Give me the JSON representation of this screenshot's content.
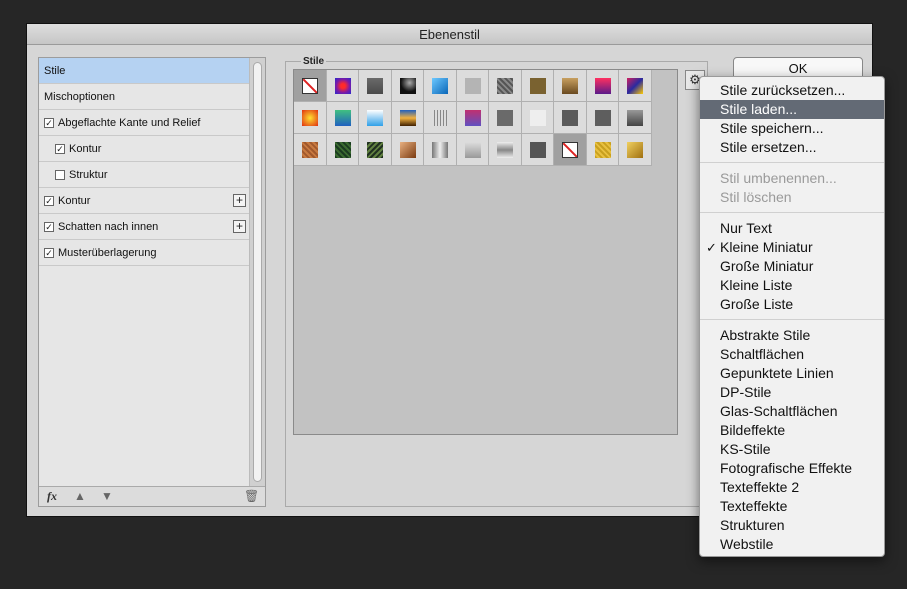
{
  "dialog": {
    "title": "Ebenenstil"
  },
  "effects": [
    {
      "label": "Stile",
      "checkbox": false,
      "selected": true,
      "indent": false,
      "plus": false
    },
    {
      "label": "Mischoptionen",
      "checkbox": false,
      "selected": false,
      "indent": false,
      "plus": false
    },
    {
      "label": "Abgeflachte Kante und Relief",
      "checkbox": true,
      "checked": true,
      "selected": false,
      "indent": false,
      "plus": false
    },
    {
      "label": "Kontur",
      "checkbox": true,
      "checked": true,
      "selected": false,
      "indent": true,
      "plus": false
    },
    {
      "label": "Struktur",
      "checkbox": true,
      "checked": false,
      "selected": false,
      "indent": true,
      "plus": false
    },
    {
      "label": "Kontur",
      "checkbox": true,
      "checked": true,
      "selected": false,
      "indent": false,
      "plus": true
    },
    {
      "label": "Schatten nach innen",
      "checkbox": true,
      "checked": true,
      "selected": false,
      "indent": false,
      "plus": true
    },
    {
      "label": "Musterüberlagerung",
      "checkbox": true,
      "checked": true,
      "selected": false,
      "indent": false,
      "plus": false
    }
  ],
  "footer": {
    "fx": "fx",
    "up_icon": "arrow-up-icon",
    "down_icon": "arrow-down-icon",
    "trash_icon": "trash-icon"
  },
  "stile_group": {
    "label": "Stile"
  },
  "ok_button": {
    "label": "OK"
  },
  "gear_icon": "gear-icon",
  "swatches": [
    "none",
    "radial-purple-red",
    "gray-square",
    "dark-glossy",
    "blue-glass",
    "light-gray",
    "textured-dark",
    "brown",
    "brown-gradient",
    "red-purple",
    "purple-mix",
    "yellow-red",
    "green-blue",
    "sky-blue",
    "sunset",
    "outline-gray",
    "blue-pink",
    "gray",
    "white-outline",
    "dark-gray",
    "dark-gray-2",
    "gradient-gray",
    "copper",
    "dark-green",
    "green-texture",
    "copper-bevel",
    "silver",
    "silver-light",
    "silver-gradient",
    "charcoal",
    "none",
    "gold",
    "gold-2"
  ],
  "selected_swatches": [
    0,
    30
  ],
  "menu": {
    "items": [
      {
        "label": "Stile zurücksetzen...",
        "state": "normal"
      },
      {
        "label": "Stile laden...",
        "state": "highlight"
      },
      {
        "label": "Stile speichern...",
        "state": "normal"
      },
      {
        "label": "Stile ersetzen...",
        "state": "normal"
      },
      {
        "label": "Stil umbenennen...",
        "state": "disabled"
      },
      {
        "label": "Stil löschen",
        "state": "disabled"
      },
      {
        "label": "Nur Text",
        "state": "normal"
      },
      {
        "label": "Kleine Miniatur",
        "state": "checked"
      },
      {
        "label": "Große Miniatur",
        "state": "normal"
      },
      {
        "label": "Kleine Liste",
        "state": "normal"
      },
      {
        "label": "Große Liste",
        "state": "normal"
      },
      {
        "label": "Abstrakte Stile",
        "state": "normal"
      },
      {
        "label": "Schaltflächen",
        "state": "normal"
      },
      {
        "label": "Gepunktete Linien",
        "state": "normal"
      },
      {
        "label": "DP-Stile",
        "state": "normal"
      },
      {
        "label": "Glas-Schaltflächen",
        "state": "normal"
      },
      {
        "label": "Bildeffekte",
        "state": "normal"
      },
      {
        "label": "KS-Stile",
        "state": "normal"
      },
      {
        "label": "Fotografische Effekte",
        "state": "normal"
      },
      {
        "label": "Texteffekte 2",
        "state": "normal"
      },
      {
        "label": "Texteffekte",
        "state": "normal"
      },
      {
        "label": "Strukturen",
        "state": "normal"
      },
      {
        "label": "Webstile",
        "state": "normal"
      }
    ],
    "check_mark": "✓"
  }
}
